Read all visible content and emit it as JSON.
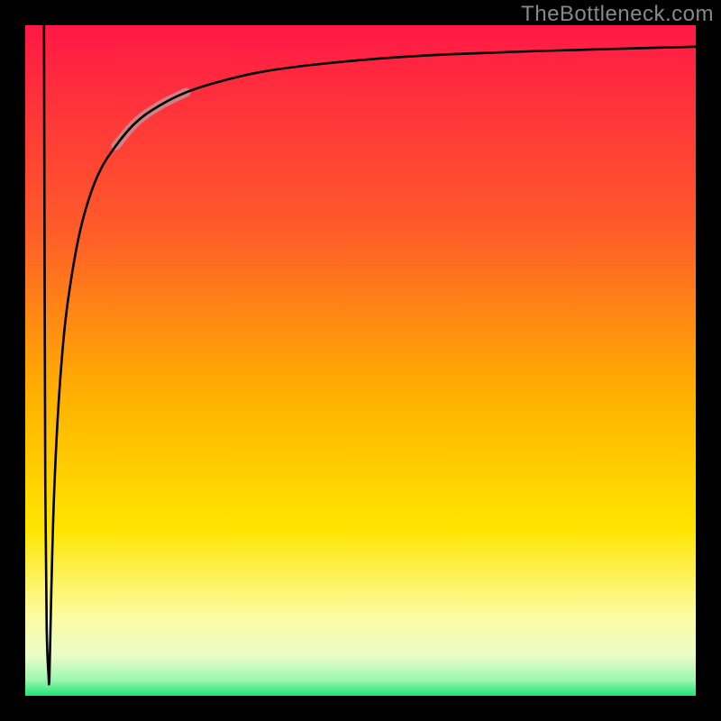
{
  "watermark": "TheBottleneck.com",
  "chart_data": {
    "type": "line",
    "title": "",
    "xlabel": "",
    "ylabel": "",
    "xlim": [
      0,
      100
    ],
    "ylim": [
      0,
      100
    ],
    "background_gradient": {
      "stops": [
        {
          "offset": 0.0,
          "color": "#ff1846"
        },
        {
          "offset": 0.3,
          "color": "#ff5a2a"
        },
        {
          "offset": 0.55,
          "color": "#ffb000"
        },
        {
          "offset": 0.75,
          "color": "#ffe500"
        },
        {
          "offset": 0.88,
          "color": "#fdfca0"
        },
        {
          "offset": 0.94,
          "color": "#e9fdc8"
        },
        {
          "offset": 0.975,
          "color": "#9cf7b1"
        },
        {
          "offset": 1.0,
          "color": "#18e36f"
        }
      ]
    },
    "frame_color": "#000000",
    "frame_thickness_ratio": 0.035,
    "curve_color": "#000000",
    "curve_width": 2.6,
    "highlight_segment": {
      "color": "#c98e93",
      "width": 10,
      "x_start": 15,
      "x_end": 22
    },
    "series": [
      {
        "name": "bottleneck-curve",
        "x": [
          2.8,
          2.9,
          3.0,
          3.2,
          3.5,
          3.55,
          3.6,
          3.7,
          3.9,
          4.3,
          5.0,
          6.0,
          7.5,
          9.0,
          11.0,
          13.5,
          16.5,
          20.0,
          24.0,
          29.0,
          35.0,
          42.0,
          50.0,
          60.0,
          72.0,
          85.0,
          100.0
        ],
        "y": [
          100.0,
          60.0,
          30.0,
          10.0,
          2.5,
          2.0,
          2.5,
          7.0,
          16.0,
          30.0,
          44.0,
          56.0,
          66.0,
          72.5,
          78.0,
          82.0,
          85.5,
          88.0,
          90.0,
          91.6,
          93.0,
          94.0,
          94.8,
          95.5,
          96.0,
          96.4,
          96.8
        ]
      }
    ]
  }
}
